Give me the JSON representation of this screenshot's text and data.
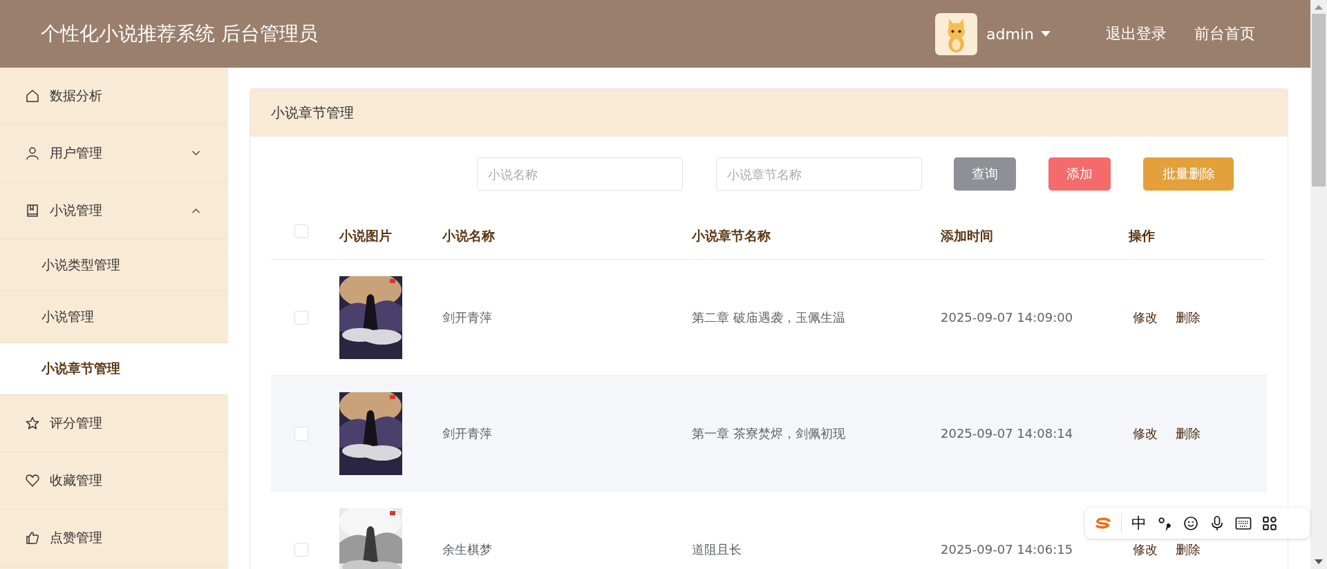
{
  "header": {
    "title": "个性化小说推荐系统 后台管理员",
    "user": "admin",
    "links": [
      "退出登录",
      "前台首页"
    ]
  },
  "sidebar": {
    "items": [
      {
        "label": "数据分析"
      },
      {
        "label": "用户管理",
        "expanded": false
      },
      {
        "label": "小说管理",
        "expanded": true,
        "children": [
          {
            "label": "小说类型管理",
            "selected": false
          },
          {
            "label": "小说管理",
            "selected": false
          },
          {
            "label": "小说章节管理",
            "selected": true
          }
        ]
      },
      {
        "label": "评分管理"
      },
      {
        "label": "收藏管理"
      },
      {
        "label": "点赞管理"
      }
    ]
  },
  "card": {
    "title": "小说章节管理",
    "search": [
      {
        "placeholder": "小说名称"
      },
      {
        "placeholder": "小说章节名称"
      }
    ],
    "buttons": [
      {
        "label": "查询",
        "kind": "query"
      },
      {
        "label": "添加",
        "kind": "add"
      },
      {
        "label": "批量删除",
        "kind": "delete"
      }
    ],
    "table": {
      "all_checked": false,
      "columns": [
        "小说图片",
        "小说名称",
        "小说章节名称",
        "添加时间",
        "操作"
      ],
      "rows": [
        {
          "checked": false,
          "cover": {
            "kind": "picture"
          },
          "name": "剑开青萍",
          "chapter": "第二章 破庙遇袭，玉佩生温",
          "time": "2025-09-07 14:09:00",
          "actions": [
            "修改",
            "删除"
          ]
        },
        {
          "checked": false,
          "cover": {
            "kind": "picture"
          },
          "name": "剑开青萍",
          "chapter": "第一章 茶寮焚烬，剑佩初现",
          "time": "2025-09-07 14:08:14",
          "actions": [
            "修改",
            "删除"
          ]
        },
        {
          "checked": false,
          "cover": {
            "kind": "picture"
          },
          "name": "余生棋梦",
          "chapter": "道阻且长",
          "time": "2025-09-07 14:06:15",
          "actions": [
            "修改",
            "删除"
          ]
        }
      ]
    }
  },
  "ime_toolbar": {
    "mode": "中"
  }
}
